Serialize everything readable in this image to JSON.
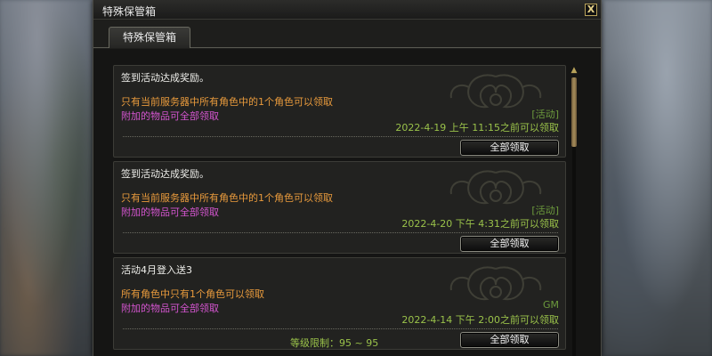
{
  "window": {
    "title": "特殊保管箱",
    "close_label": "X"
  },
  "tabs": [
    {
      "label": "特殊保管箱"
    }
  ],
  "accent_colors": {
    "orange_text": "#e89a3c",
    "pink_text": "#d455cf",
    "green_text": "#9ac24a",
    "tag_text": "#6c9a3c"
  },
  "cards": [
    {
      "title": "签到活动达成奖励。",
      "line1": "只有当前服务器中所有角色中的1个角色可以领取",
      "line2": "附加的物品可全部领取",
      "tag": "[活动]",
      "deadline": "2022-4-19 上午 11:15之前可以领取",
      "level_limit": "",
      "button_label": "全部领取"
    },
    {
      "title": "签到活动达成奖励。",
      "line1": "只有当前服务器中所有角色中的1个角色可以领取",
      "line2": "附加的物品可全部领取",
      "tag": "[活动]",
      "deadline": "2022-4-20 下午 4:31之前可以领取",
      "level_limit": "",
      "button_label": "全部领取"
    },
    {
      "title": "活动4月登入送3",
      "line1": "所有角色中只有1个角色可以领取",
      "line2": "附加的物品可全部领取",
      "tag": "GM",
      "deadline": "2022-4-14 下午 2:00之前可以领取",
      "level_limit": "等级限制：95 ~ 95",
      "button_label": "全部领取"
    }
  ],
  "scrollbar": {
    "up_icon": "scroll-up-arrow-icon",
    "position_fraction": 0.0
  }
}
